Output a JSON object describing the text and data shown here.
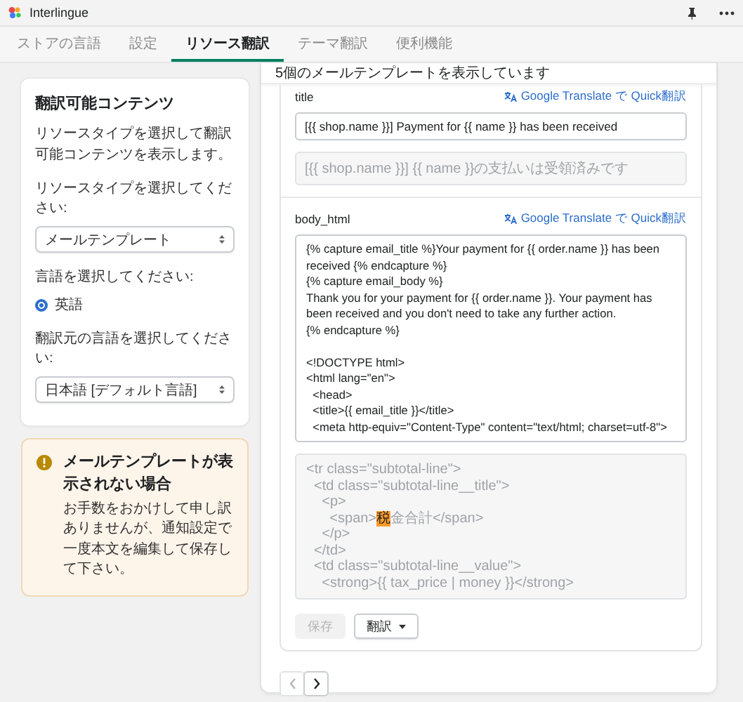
{
  "app": {
    "name": "Interlingue"
  },
  "tabs": [
    {
      "label": "ストアの言語",
      "selected": false
    },
    {
      "label": "設定",
      "selected": false
    },
    {
      "label": "リソース翻訳",
      "selected": true
    },
    {
      "label": "テーマ翻訳",
      "selected": false
    },
    {
      "label": "便利機能",
      "selected": false
    }
  ],
  "sidebar": {
    "title": "翻訳可能コンテンツ",
    "description": "リソースタイプを選択して翻訳可能コンテンツを表示します。",
    "resource_label": "リソースタイプを選択してください:",
    "resource_value": "メールテンプレート",
    "language_label": "言語を選択してください:",
    "languages": [
      {
        "label": "英語",
        "selected": true
      }
    ],
    "source_label": "翻訳元の言語を選択してください:",
    "source_value": "日本語 [デフォルト言語]"
  },
  "notice": {
    "title": "メールテンプレートが表示されない場合",
    "message": "お手数をおかけして申し訳ありませんが、通知設定で一度本文を編集して保存して下さい。"
  },
  "panel": {
    "header": "5個のメールテンプレートを表示しています",
    "fields": [
      {
        "kind": "single_line",
        "label": "title",
        "quick_translate": "Google Translate で Quick翻訳",
        "value": "[{{ shop.name }}] Payment for {{ name }} has been received",
        "source_lines": [
          {
            "parts": [
              {
                "text": "[{{ shop.name }}] {{ name }}の支払いは受領済みです",
                "highlighted": false
              }
            ]
          }
        ]
      },
      {
        "kind": "multi_line",
        "label": "body_html",
        "quick_translate": "Google Translate で Quick翻訳",
        "value": "{% capture email_title %}Your payment for {{ order.name }} has been received {% endcapture %}\n{% capture email_body %}\nThank you for your payment for {{ order.name }}. Your payment has been received and you don't need to take any further action.\n{% endcapture %}\n\n<!DOCTYPE html>\n<html lang=\"en\">\n  <head>\n  <title>{{ email_title }}</title>\n  <meta http-equiv=\"Content-Type\" content=\"text/html; charset=utf-8\">",
        "source_lines": [
          {
            "parts": [
              {
                "text": "<tr class=\"subtotal-line\">",
                "highlighted": false
              }
            ]
          },
          {
            "parts": [
              {
                "text": "  <td class=\"subtotal-line__title\">",
                "highlighted": false
              }
            ]
          },
          {
            "parts": [
              {
                "text": "    <p>",
                "highlighted": false
              }
            ]
          },
          {
            "parts": [
              {
                "text": "      <span>",
                "highlighted": false
              },
              {
                "text": "税",
                "highlighted": true
              },
              {
                "text": "金合計</span>",
                "highlighted": false
              }
            ]
          },
          {
            "parts": [
              {
                "text": "    </p>",
                "highlighted": false
              }
            ]
          },
          {
            "parts": [
              {
                "text": "  </td>",
                "highlighted": false
              }
            ]
          },
          {
            "parts": [
              {
                "text": "  <td class=\"subtotal-line__value\">",
                "highlighted": false
              }
            ]
          },
          {
            "parts": [
              {
                "text": "    <strong>{{ tax_price | money }}</strong>",
                "highlighted": false
              }
            ]
          }
        ]
      }
    ],
    "buttons": [
      {
        "kind": "plain",
        "label": "保存",
        "disabled": true
      },
      {
        "kind": "menu",
        "label": "翻訳",
        "disabled": false
      }
    ],
    "pagination": {
      "previous_disabled": true,
      "next_disabled": false
    }
  }
}
